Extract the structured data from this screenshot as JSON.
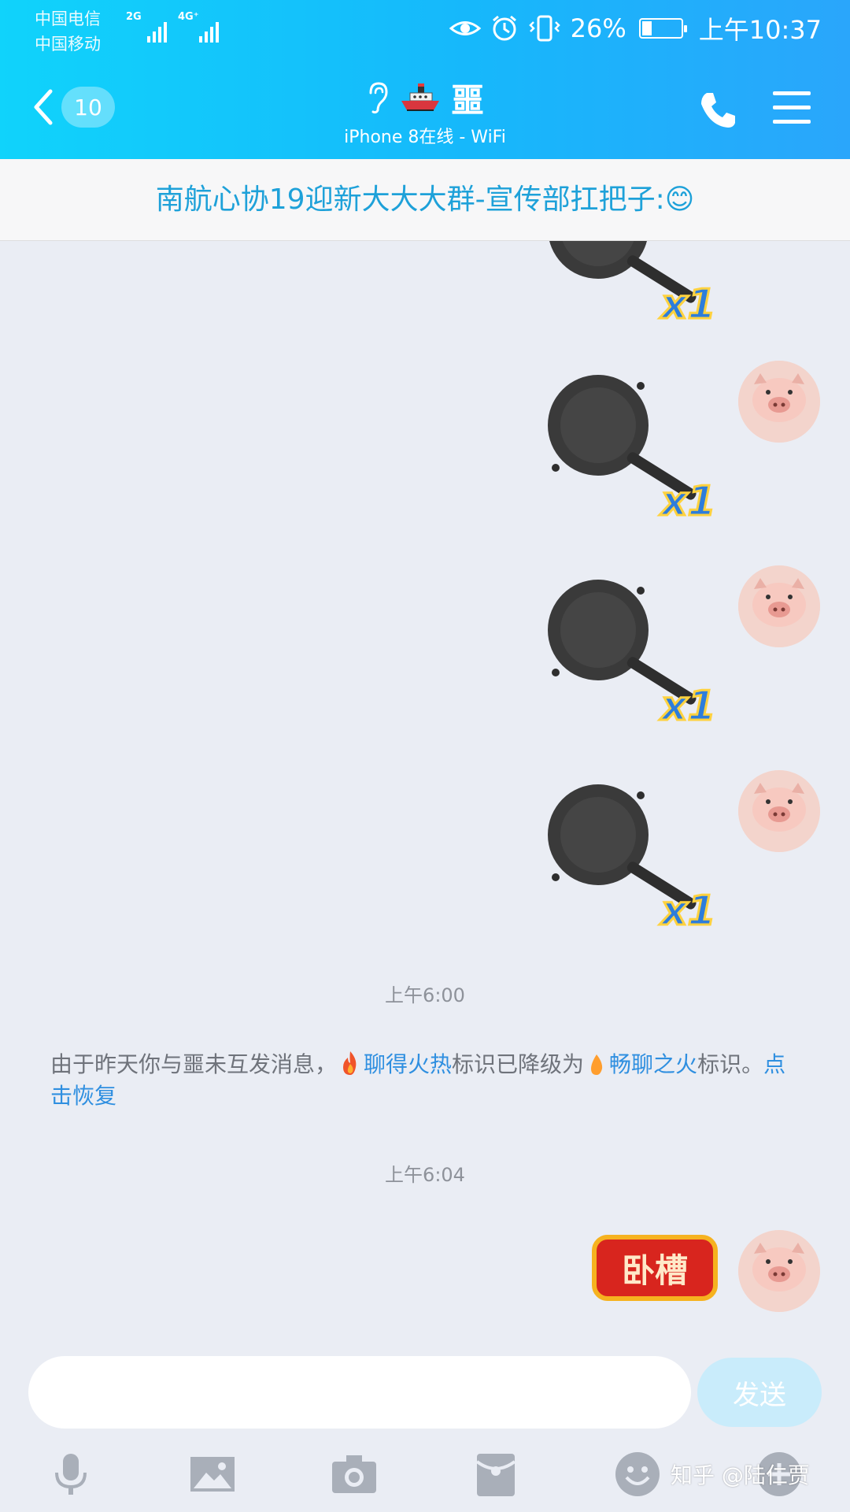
{
  "status_bar": {
    "carrier_1": "中国电信",
    "carrier_2": "中国移动",
    "net_1": "2G",
    "net_2": "4G⁺",
    "battery_percent": "26%",
    "battery_level": 0.26,
    "time": "上午10:37",
    "icons": [
      "eye-icon",
      "alarm-icon",
      "vibrate-icon",
      "battery-icon"
    ]
  },
  "header": {
    "back_badge": "10",
    "title": "噩",
    "subtitle": "iPhone 8在线 - WiFi",
    "icons": [
      "ear-icon",
      "ship-icon",
      "phone-icon",
      "menu-icon"
    ]
  },
  "notice": {
    "text": "南航心协19迎新大大大群-宣传部扛把子:",
    "emoji": "😊"
  },
  "chat": {
    "sticker_count_label": "x1",
    "timestamp_1": "上午6:00",
    "system_message": {
      "part1": "由于昨天你与噩未互发消息，",
      "badge1": "聊得火热",
      "part2": "标识已降级为",
      "badge2": "畅聊之火",
      "part3": "标识。",
      "link": "点击恢复"
    },
    "timestamp_2": "上午6:04",
    "last_sticker_text": "卧槽"
  },
  "input": {
    "placeholder": "",
    "send_label": "发送"
  },
  "toolbar": {
    "icons": [
      "microphone-icon",
      "image-icon",
      "camera-icon",
      "red-packet-icon",
      "emoji-icon",
      "more-icon"
    ]
  },
  "watermark": "知乎 @陆仁贾",
  "colors": {
    "header_gradient_start": "#10d3fb",
    "header_gradient_end": "#2aa6fb",
    "chat_background": "#eaedf4",
    "link_blue": "#2f8fe0",
    "send_button": "#c9ecfb"
  }
}
